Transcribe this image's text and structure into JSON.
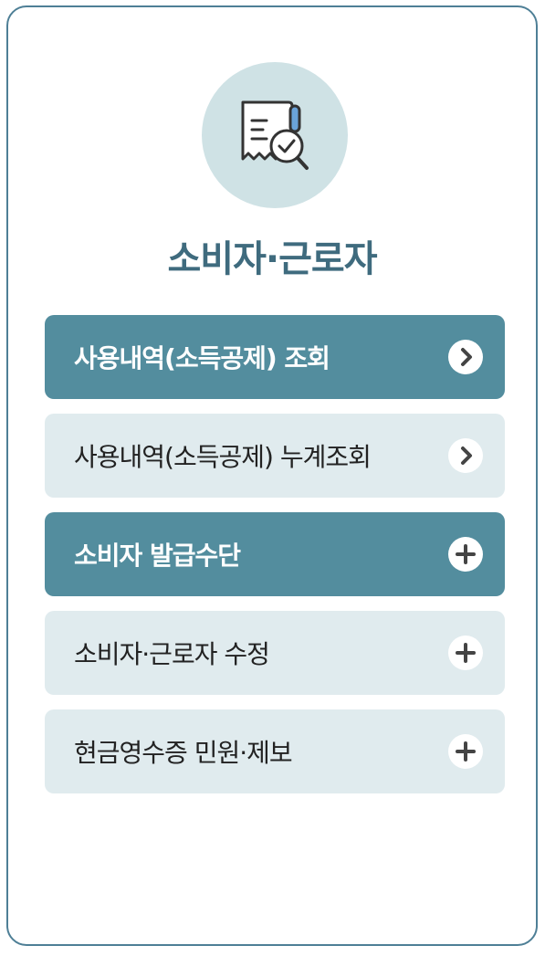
{
  "header": {
    "icon": "receipt-search-icon",
    "title": "소비자·근로자"
  },
  "menu": {
    "items": [
      {
        "label": "사용내역(소득공제) 조회",
        "icon": "chevron-right-icon",
        "state": "active"
      },
      {
        "label": "사용내역(소득공제) 누계조회",
        "icon": "chevron-right-icon",
        "state": "inactive"
      },
      {
        "label": "소비자 발급수단",
        "icon": "plus-icon",
        "state": "active"
      },
      {
        "label": "소비자·근로자 수정",
        "icon": "plus-icon",
        "state": "inactive"
      },
      {
        "label": "현금영수증 민원·제보",
        "icon": "plus-icon",
        "state": "inactive"
      }
    ]
  },
  "colors": {
    "border": "#4e7f96",
    "title": "#3f6b7e",
    "active_bg": "#538d9e",
    "inactive_bg": "#e0ebee",
    "icon_circle": "#cfe2e5"
  }
}
